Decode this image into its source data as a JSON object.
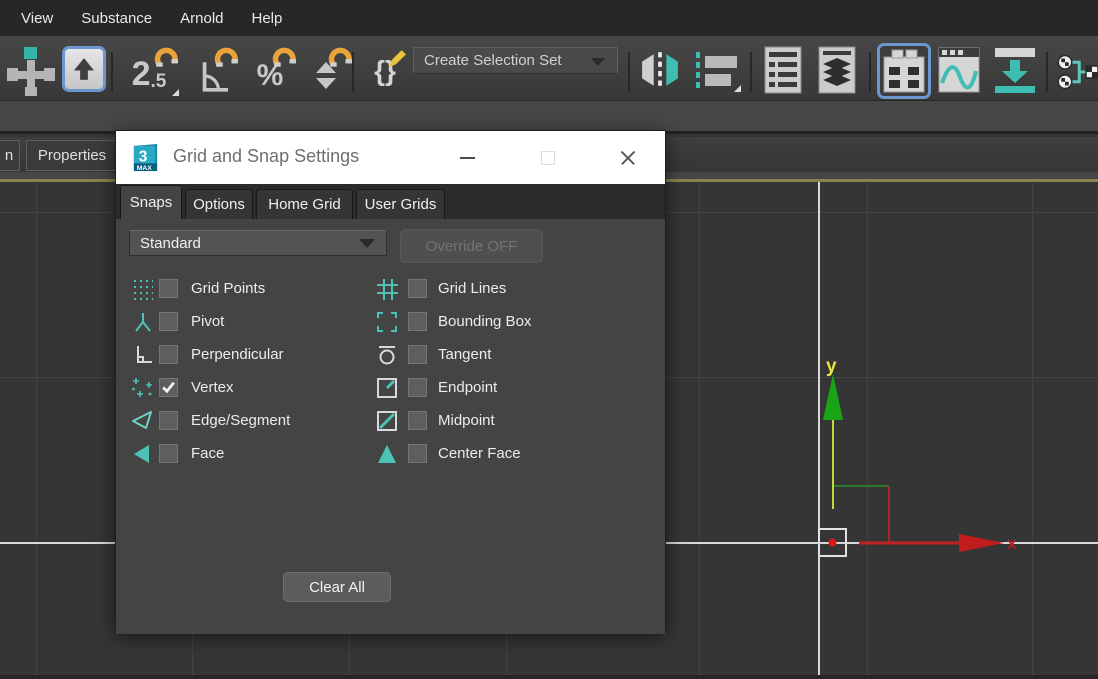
{
  "menu_bar": {
    "items": [
      {
        "label": "View"
      },
      {
        "label": "Substance"
      },
      {
        "label": "Arnold"
      },
      {
        "label": "Help"
      }
    ]
  },
  "toolbar": {
    "snap_toggle": {
      "main": "2",
      "sub": ".5"
    },
    "percent_glyph": "%",
    "braces_glyph": "{}",
    "selection_set": {
      "value": "Create Selection Set"
    }
  },
  "panel_tabs": {
    "items": [
      {
        "label": "n"
      },
      {
        "label": "Properties"
      }
    ]
  },
  "dialog": {
    "app_logo": {
      "number": "3",
      "badge": "MAX"
    },
    "title": "Grid and Snap Settings",
    "tabs": [
      {
        "label": "Snaps",
        "active": true
      },
      {
        "label": "Options",
        "active": false
      },
      {
        "label": "Home Grid",
        "active": false
      },
      {
        "label": "User Grids",
        "active": false
      }
    ],
    "preset": {
      "value": "Standard"
    },
    "override": {
      "label": "Override OFF",
      "enabled": false
    },
    "options_left": [
      {
        "label": "Grid Points",
        "checked": false
      },
      {
        "label": "Pivot",
        "checked": false
      },
      {
        "label": "Perpendicular",
        "checked": false
      },
      {
        "label": "Vertex",
        "checked": true
      },
      {
        "label": "Edge/Segment",
        "checked": false
      },
      {
        "label": "Face",
        "checked": false
      }
    ],
    "options_right": [
      {
        "label": "Grid Lines",
        "checked": false
      },
      {
        "label": "Bounding Box",
        "checked": false
      },
      {
        "label": "Tangent",
        "checked": false
      },
      {
        "label": "Endpoint",
        "checked": false
      },
      {
        "label": "Midpoint",
        "checked": false
      },
      {
        "label": "Center Face",
        "checked": false
      }
    ],
    "clear_all": "Clear All"
  },
  "viewport": {
    "axis_labels": {
      "x": "x",
      "y": "y"
    }
  },
  "colors": {
    "accent_teal": "#3fbdb2",
    "magnet_orange": "#e8a33a",
    "selection_blue": "#6b97ce",
    "axis_x_red": "#c32222",
    "axis_y_green": "#1ea51e",
    "axis_label_yellow": "#ece43c",
    "viewport_border_olive": "#8c8150",
    "dialog_bg": "#444444",
    "titlebar_bg": "#ffffff"
  }
}
